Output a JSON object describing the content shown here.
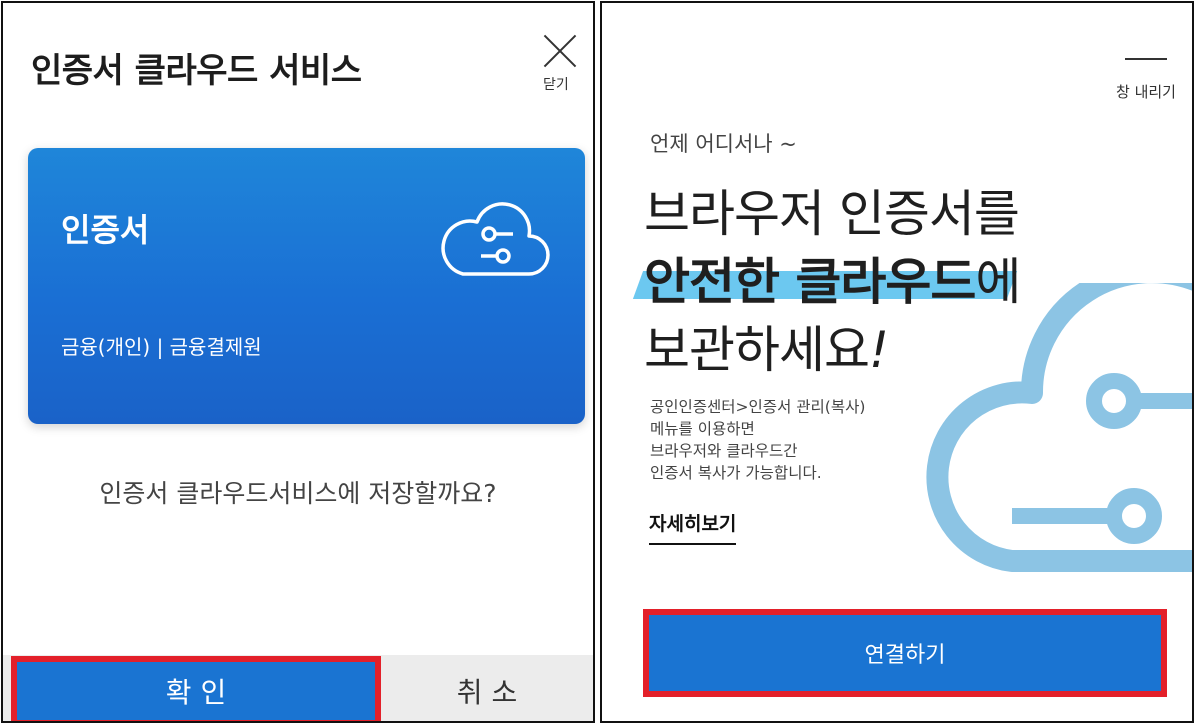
{
  "left_dialog": {
    "title": "인증서 클라우드 서비스",
    "close_label": "닫기",
    "card": {
      "title": "인증서",
      "subtitle": "금융(개인) | 금융결제원"
    },
    "question": "인증서 클라우드서비스에 저장할까요?",
    "confirm_label": "확 인",
    "cancel_label": "취 소"
  },
  "right_dialog": {
    "minimize_label": "창 내리기",
    "tagline": "언제 어디서나 ~",
    "headline": {
      "line1": "브라우저 인증서를",
      "line2_highlight": "안전한 클라우드",
      "line2_rest": "에",
      "line3": "보관하세요",
      "line3_mark": "!"
    },
    "description": [
      "공인인증센터>인증서 관리(복사)",
      "메뉴를 이용하면",
      "브라우저와 클라우드간",
      "인증서 복사가 가능합니다."
    ],
    "detail_link": "자세히보기",
    "connect_label": "연결하기"
  },
  "colors": {
    "primary_blue": "#1a74d2",
    "highlight_border": "#e3202a",
    "accent_cyan": "#6cc8f0",
    "cloud_outline": "#8cc4e4"
  },
  "icons": {
    "close": "close-icon",
    "card_cloud": "cloud-connect-icon",
    "decorative_cloud": "cloud-illustration"
  }
}
